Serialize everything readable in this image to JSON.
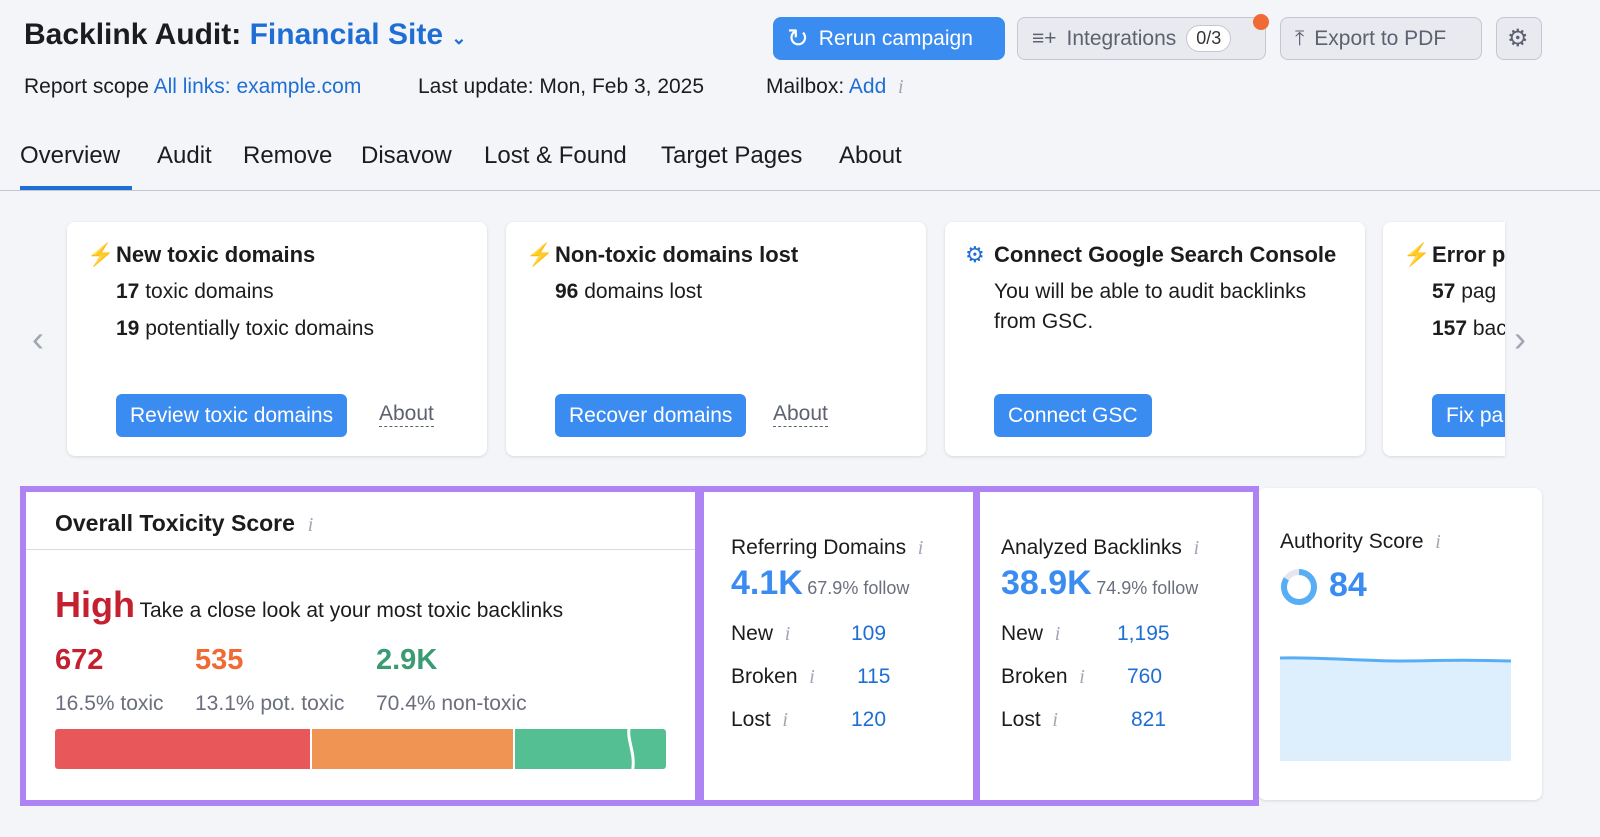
{
  "header": {
    "title_prefix": "Backlink Audit:",
    "site": "Financial Site",
    "rerun": "Rerun campaign",
    "integrations": "Integrations",
    "integrations_count": "0/3",
    "export": "Export to PDF"
  },
  "meta": {
    "scope_label": "Report scope",
    "scope_value": "All links: example.com",
    "last_update": "Last update: Mon, Feb 3, 2025",
    "mailbox_label": "Mailbox:",
    "mailbox_add": "Add"
  },
  "tabs": [
    "Overview",
    "Audit",
    "Remove",
    "Disavow",
    "Lost & Found",
    "Target Pages",
    "About"
  ],
  "cards": [
    {
      "title": "New toxic domains",
      "l1b": "17",
      "l1": " toxic domains",
      "l2b": "19",
      "l2": " potentially toxic domains",
      "button": "Review toxic domains",
      "about": "About"
    },
    {
      "title": "Non-toxic domains lost",
      "l1b": "96",
      "l1": " domains lost",
      "button": "Recover domains",
      "about": "About"
    },
    {
      "title": "Connect Google Search Console",
      "l1": "You will be able to audit backlinks",
      "l2": "from GSC.",
      "button": "Connect GSC"
    },
    {
      "title": "Error pa",
      "l1b": "57",
      "l1": " pag",
      "l2b": "157",
      "l2": " bac",
      "button": "Fix pa"
    }
  ],
  "toxicity": {
    "title": "Overall Toxicity Score",
    "level": "High",
    "desc": "Take a close look at your most toxic backlinks",
    "stats": [
      {
        "value": "672",
        "label": "16.5% toxic",
        "color": "#c4202f"
      },
      {
        "value": "535",
        "label": "13.1% pot. toxic",
        "color": "#ef6a34"
      },
      {
        "value": "2.9K",
        "label": "70.4% non-toxic",
        "color": "#3a9b74"
      }
    ]
  },
  "referring": {
    "title": "Referring Domains",
    "value": "4.1K",
    "follow": "67.9% follow",
    "rows": [
      {
        "label": "New",
        "value": "109"
      },
      {
        "label": "Broken",
        "value": "115"
      },
      {
        "label": "Lost",
        "value": "120"
      }
    ]
  },
  "backlinks": {
    "title": "Analyzed Backlinks",
    "value": "38.9K",
    "follow": "74.9% follow",
    "rows": [
      {
        "label": "New",
        "value": "1,195"
      },
      {
        "label": "Broken",
        "value": "760"
      },
      {
        "label": "Lost",
        "value": "821"
      }
    ]
  },
  "authority": {
    "title": "Authority Score",
    "value": "84"
  },
  "info": "i"
}
